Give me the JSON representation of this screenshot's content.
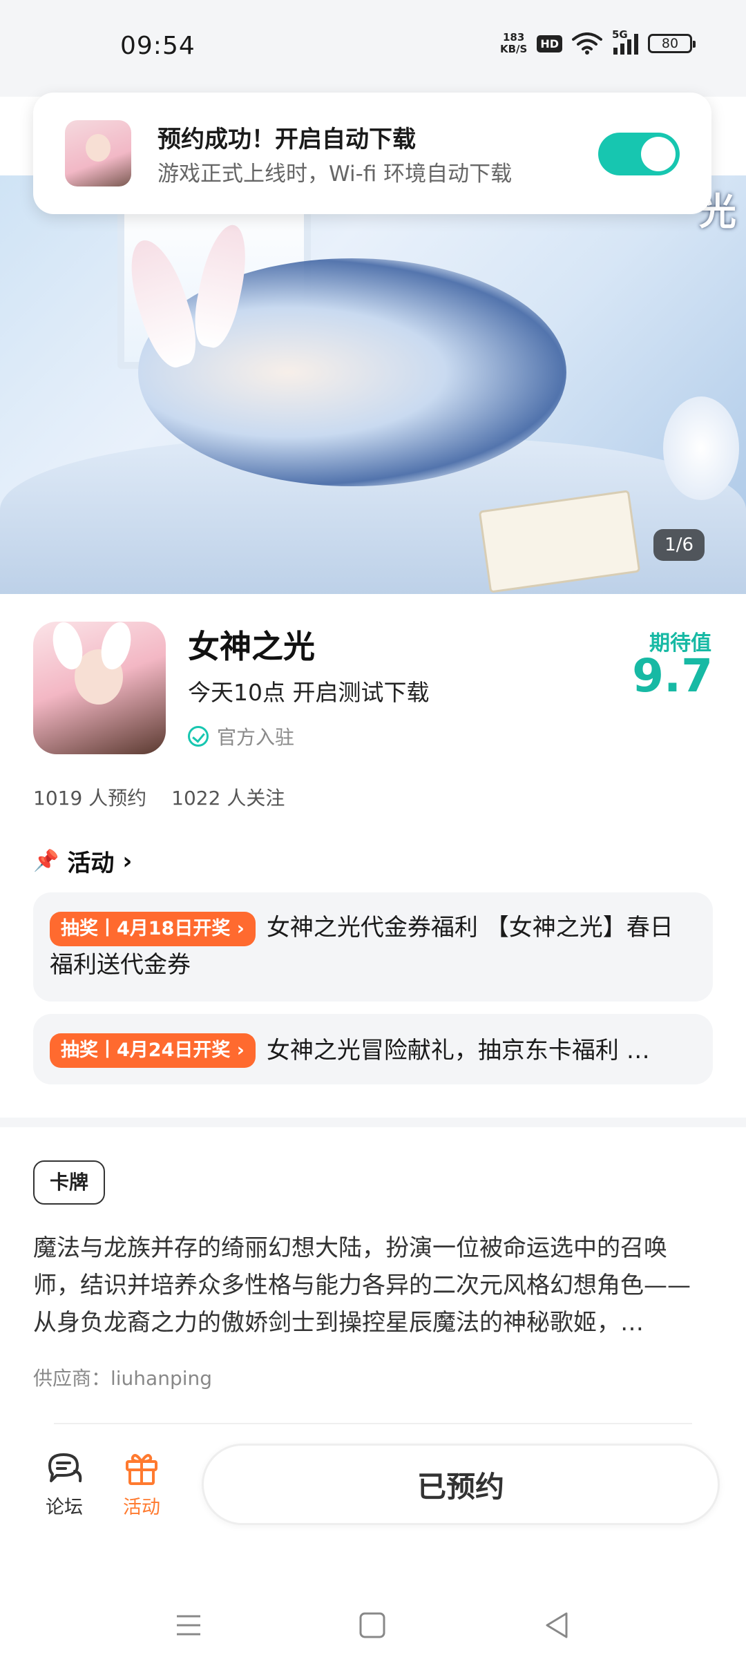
{
  "status_bar": {
    "time": "09:54",
    "net_speed_value": "183",
    "net_speed_unit": "KB/S",
    "hd_badge": "HD",
    "network": "5G",
    "battery": "80"
  },
  "notification": {
    "title": "预约成功！开启自动下载",
    "subtitle": "游戏正式上线时，Wi-fi 环境自动下载",
    "toggle_on": true
  },
  "hero": {
    "corner_text": "光",
    "counter": "1/6"
  },
  "app": {
    "name": "女神之光",
    "subtitle": "今天10点 开启测试下载",
    "verified_label": "官方入驻",
    "score_label": "期待值",
    "score_value": "9.7",
    "reservations": "1019 人预约",
    "followers": "1022 人关注"
  },
  "activity": {
    "header": "活动",
    "items": [
      {
        "tag": "抽奖丨4月18日开奖 ›",
        "text": "女神之光代金券福利 【女神之光】春日福利送代金券"
      },
      {
        "tag": "抽奖丨4月24日开奖 ›",
        "text": "女神之光冒险献礼，抽京东卡福利 …"
      }
    ]
  },
  "details": {
    "genre_tag": "卡牌",
    "description": "魔法与龙族并存的绮丽幻想大陆，扮演一位被命运选中的召唤师，结识并培养众多性格与能力各异的二次元风格幻想角色——从身负龙裔之力的傲娇剑士到操控星辰魔法的神秘歌姬，…",
    "supplier": "供应商：liuhanping"
  },
  "bottom_bar": {
    "forum_label": "论坛",
    "activity_label": "活动",
    "reserved_button": "已预约"
  },
  "colors": {
    "accent_teal": "#17c6b0",
    "accent_orange": "#ff6a2f",
    "nav_active_orange": "#ff7a2f"
  },
  "icons": {
    "pin": "pin-icon",
    "chevron": "chevron-right-icon",
    "verified": "check-circle-icon",
    "forum": "chat-bubble-icon",
    "gift": "gift-icon"
  }
}
